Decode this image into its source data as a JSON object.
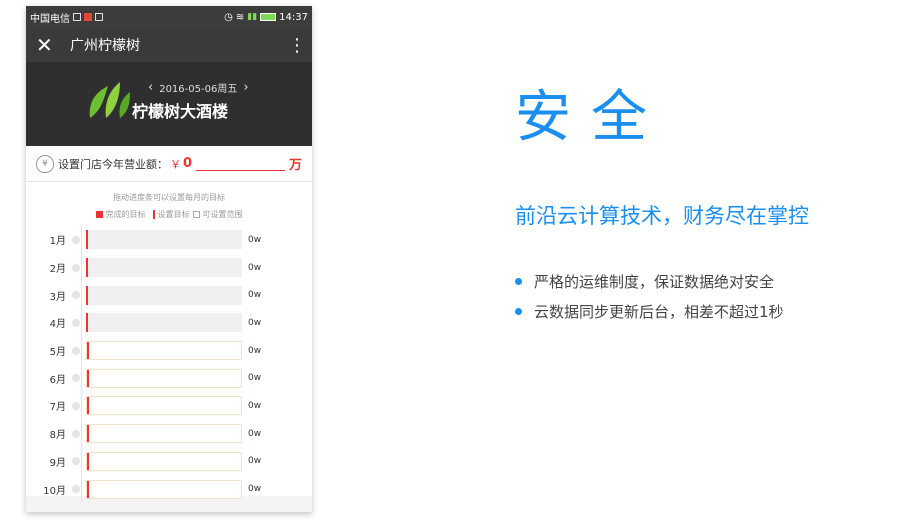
{
  "statusbar": {
    "carrier": "中国电信",
    "time": "14:37"
  },
  "titlebar": {
    "close_icon": "close-icon",
    "title": "广州柠檬树",
    "menu_icon": "more-vertical-icon"
  },
  "header": {
    "date": "2016-05-06周五",
    "hotel_name": "柠檬树大酒楼"
  },
  "target": {
    "label": "设置门店今年营业额：",
    "currency": "￥",
    "amount": "0",
    "unit": "万"
  },
  "chart_hint": "拖动进度条可以设置每月的目标",
  "legend": {
    "done": "完成的目标",
    "set": "设置目标",
    "range": "可设置范围"
  },
  "months": [
    {
      "label": "1月",
      "value": "0w",
      "state": "past"
    },
    {
      "label": "2月",
      "value": "0w",
      "state": "past"
    },
    {
      "label": "3月",
      "value": "0w",
      "state": "past"
    },
    {
      "label": "4月",
      "value": "0w",
      "state": "past"
    },
    {
      "label": "5月",
      "value": "0w",
      "state": "future"
    },
    {
      "label": "6月",
      "value": "0w",
      "state": "future"
    },
    {
      "label": "7月",
      "value": "0w",
      "state": "future"
    },
    {
      "label": "8月",
      "value": "0w",
      "state": "future"
    },
    {
      "label": "9月",
      "value": "0w",
      "state": "future"
    },
    {
      "label": "10月",
      "value": "0w",
      "state": "future"
    }
  ],
  "promo": {
    "title": "安全",
    "subtitle": "前沿云计算技术，财务尽在掌控",
    "bullets": [
      "严格的运维制度，保证数据绝对安全",
      "云数据同步更新后台，相差不超过1秒"
    ]
  },
  "colors": {
    "accent": "#1a8ff0",
    "target_red": "#e33",
    "header_dark": "#2f2f2f"
  }
}
